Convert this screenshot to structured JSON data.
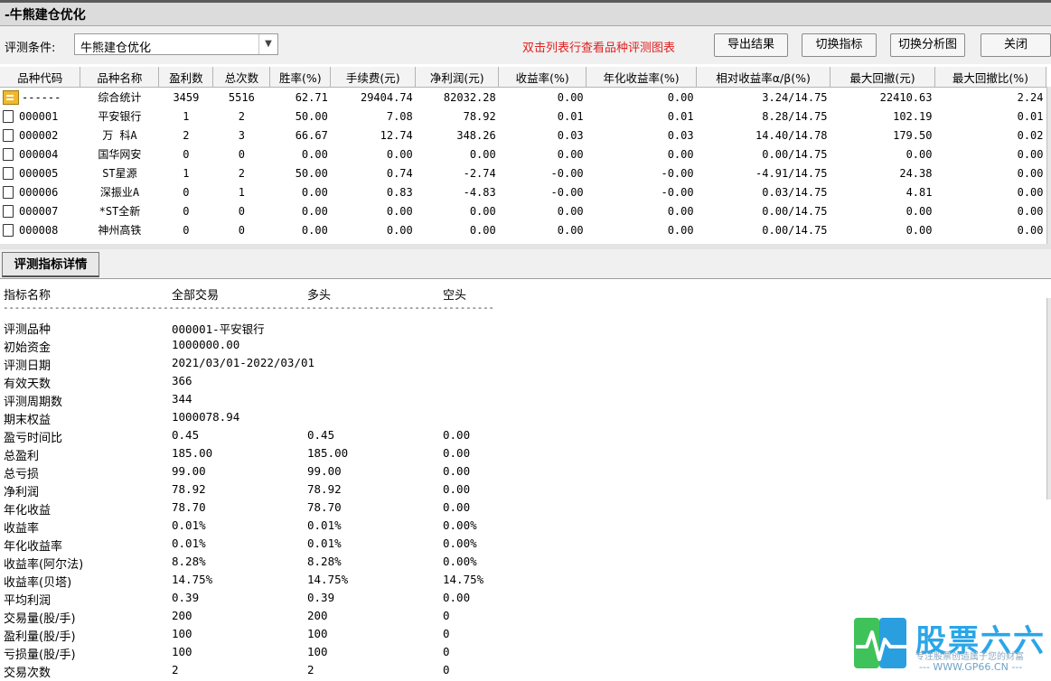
{
  "window": {
    "title": "-牛熊建仓优化"
  },
  "toolbar": {
    "condition_label": "评测条件:",
    "condition_value": "牛熊建仓优化",
    "hint": "双击列表行查看品种评测图表",
    "export_label": "导出结果",
    "switch_indicator_label": "切换指标",
    "switch_chart_label": "切换分析图",
    "close_label": "关闭"
  },
  "grid": {
    "headers": [
      "品种代码",
      "品种名称",
      "盈利数",
      "总次数",
      "胜率(%)",
      "手续费(元)",
      "净利润(元)",
      "收益率(%)",
      "年化收益率(%)",
      "相对收益率α/β(%)",
      "最大回撤(元)",
      "最大回撤比(%)"
    ],
    "rows": [
      [
        "------",
        "综合统计",
        "3459",
        "5516",
        "62.71",
        "29404.74",
        "82032.28",
        "0.00",
        "0.00",
        "3.24/14.75",
        "22410.63",
        "2.24"
      ],
      [
        "000001",
        "平安银行",
        "1",
        "2",
        "50.00",
        "7.08",
        "78.92",
        "0.01",
        "0.01",
        "8.28/14.75",
        "102.19",
        "0.01"
      ],
      [
        "000002",
        "万 科A",
        "2",
        "3",
        "66.67",
        "12.74",
        "348.26",
        "0.03",
        "0.03",
        "14.40/14.78",
        "179.50",
        "0.02"
      ],
      [
        "000004",
        "国华网安",
        "0",
        "0",
        "0.00",
        "0.00",
        "0.00",
        "0.00",
        "0.00",
        "0.00/14.75",
        "0.00",
        "0.00"
      ],
      [
        "000005",
        "ST星源",
        "1",
        "2",
        "50.00",
        "0.74",
        "-2.74",
        "-0.00",
        "-0.00",
        "-4.91/14.75",
        "24.38",
        "0.00"
      ],
      [
        "000006",
        "深振业A",
        "0",
        "1",
        "0.00",
        "0.83",
        "-4.83",
        "-0.00",
        "-0.00",
        "0.03/14.75",
        "4.81",
        "0.00"
      ],
      [
        "000007",
        "*ST全新",
        "0",
        "0",
        "0.00",
        "0.00",
        "0.00",
        "0.00",
        "0.00",
        "0.00/14.75",
        "0.00",
        "0.00"
      ],
      [
        "000008",
        "神州高铁",
        "0",
        "0",
        "0.00",
        "0.00",
        "0.00",
        "0.00",
        "0.00",
        "0.00/14.75",
        "0.00",
        "0.00"
      ]
    ]
  },
  "tab": {
    "label": "评测指标详情"
  },
  "detail": {
    "headers": {
      "name": "指标名称",
      "all": "全部交易",
      "long": "多头",
      "short": "空头"
    },
    "separator": "--------------------------------------------------------------------------------------",
    "rows": [
      {
        "name": "评测品种",
        "all": "000001-平安银行",
        "long": "",
        "short": ""
      },
      {
        "name": "初始资金",
        "all": "1000000.00",
        "long": "",
        "short": ""
      },
      {
        "name": "评测日期",
        "all": "2021/03/01-2022/03/01",
        "long": "",
        "short": ""
      },
      {
        "name": "有效天数",
        "all": "366",
        "long": "",
        "short": ""
      },
      {
        "name": "评测周期数",
        "all": "344",
        "long": "",
        "short": ""
      },
      {
        "name": "期末权益",
        "all": "1000078.94",
        "long": "",
        "short": ""
      },
      {
        "name": "盈亏时间比",
        "all": "0.45",
        "long": "0.45",
        "short": "0.00"
      },
      {
        "name": "总盈利",
        "all": "185.00",
        "long": "185.00",
        "short": "0.00"
      },
      {
        "name": "总亏损",
        "all": "99.00",
        "long": "99.00",
        "short": "0.00"
      },
      {
        "name": "净利润",
        "all": "78.92",
        "long": "78.92",
        "short": "0.00"
      },
      {
        "name": "年化收益",
        "all": "78.70",
        "long": "78.70",
        "short": "0.00"
      },
      {
        "name": "收益率",
        "all": "0.01%",
        "long": "0.01%",
        "short": "0.00%"
      },
      {
        "name": "年化收益率",
        "all": "0.01%",
        "long": "0.01%",
        "short": "0.00%"
      },
      {
        "name": "收益率(阿尔法)",
        "all": "8.28%",
        "long": "8.28%",
        "short": "0.00%"
      },
      {
        "name": "收益率(贝塔)",
        "all": "14.75%",
        "long": "14.75%",
        "short": "14.75%"
      },
      {
        "name": "平均利润",
        "all": "0.39",
        "long": "0.39",
        "short": "0.00"
      },
      {
        "name": "交易量(股/手)",
        "all": "200",
        "long": "200",
        "short": "0"
      },
      {
        "name": "盈利量(股/手)",
        "all": "100",
        "long": "100",
        "short": "0"
      },
      {
        "name": "亏损量(股/手)",
        "all": "100",
        "long": "100",
        "short": "0"
      },
      {
        "name": "交易次数",
        "all": "2",
        "long": "2",
        "short": "0"
      }
    ]
  },
  "watermark": {
    "brand": "股票六六",
    "slogan": "专注股票创造属于您的财富",
    "url": "--- WWW.GP66.CN ---"
  },
  "colors": {
    "hint": "#e02020",
    "brand": "#2aa6e8"
  }
}
